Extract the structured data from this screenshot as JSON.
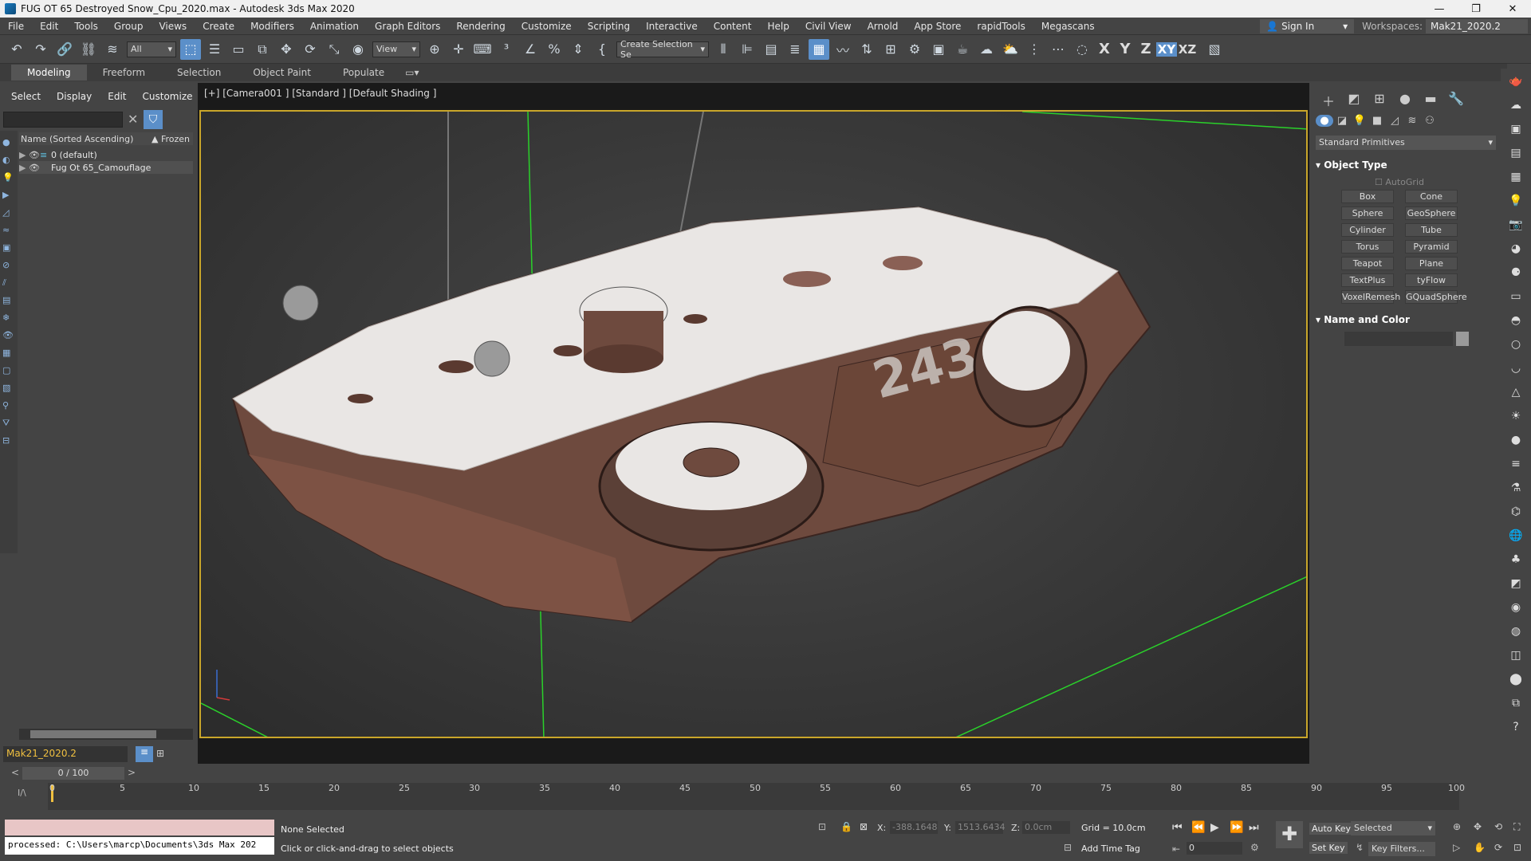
{
  "window": {
    "title": "FUG OT 65 Destroyed Snow_Cpu_2020.max - Autodesk 3ds Max 2020",
    "controls": [
      "—",
      "❐",
      "✕"
    ]
  },
  "menubar": {
    "items": [
      "File",
      "Edit",
      "Tools",
      "Group",
      "Views",
      "Create",
      "Modifiers",
      "Animation",
      "Graph Editors",
      "Rendering",
      "Customize",
      "Scripting",
      "Interactive",
      "Content",
      "Help",
      "Civil View",
      "Arnold",
      "App Store",
      "rapidTools",
      "Megascans"
    ],
    "sign_in": "Sign In",
    "workspaces_label": "Workspaces:",
    "workspace": "Mak21_2020.2"
  },
  "toolbar": {
    "selection_filter": "All",
    "ref_coord": "View",
    "create_selection_set": "Create Selection Se",
    "axes": [
      "X",
      "Y",
      "Z",
      "XY",
      "XZ"
    ]
  },
  "ribbon": {
    "tabs": [
      "Modeling",
      "Freeform",
      "Selection",
      "Object Paint",
      "Populate"
    ]
  },
  "explorer": {
    "menu": [
      "Select",
      "Display",
      "Edit",
      "Customize"
    ],
    "column_header": "Name (Sorted Ascending)",
    "frozen_header": "▲ Frozen",
    "rows": [
      "0 (default)",
      "Fug Ot 65_Camouflage"
    ],
    "layer": "Mak21_2020.2"
  },
  "viewport": {
    "label": "[+] [Camera001 ] [Standard ] [Default Shading ]",
    "decal_text": "243"
  },
  "cmdpanel": {
    "dropdown": "Standard Primitives",
    "object_type_title": "Object Type",
    "autogrid": "AutoGrid",
    "buttons": [
      "Box",
      "Cone",
      "Sphere",
      "GeoSphere",
      "Cylinder",
      "Tube",
      "Torus",
      "Pyramid",
      "Teapot",
      "Plane",
      "TextPlus",
      "tyFlow",
      "VoxelRemesh",
      "GQuadSphere"
    ],
    "name_color_title": "Name and Color"
  },
  "timeslider": {
    "frame": "0 / 100",
    "ticks": [
      "0",
      "5",
      "10",
      "15",
      "20",
      "25",
      "30",
      "35",
      "40",
      "45",
      "50",
      "55",
      "60",
      "65",
      "70",
      "75",
      "80",
      "85",
      "90",
      "95",
      "100"
    ]
  },
  "status": {
    "maxscript_output": "processed: C:\\Users\\marcp\\Documents\\3ds Max 202",
    "selection": "None Selected",
    "prompt": "Click or click-and-drag to select objects",
    "x_label": "X:",
    "x_value": "-388.1648",
    "y_label": "Y:",
    "y_value": "1513.6434",
    "z_label": "Z:",
    "z_value": "0.0cm",
    "grid": "Grid = 10.0cm",
    "add_time_tag": "Add Time Tag",
    "auto_key": "Auto Key",
    "set_key": "Set Key",
    "selected": "Selected",
    "key_filters": "Key Filters...",
    "current_frame": "0"
  },
  "colors": {
    "accent": "#5b8fc9",
    "viewport_border": "#c9a62a",
    "grid_line": "#2ad12a",
    "layer_text": "#f0c040"
  }
}
